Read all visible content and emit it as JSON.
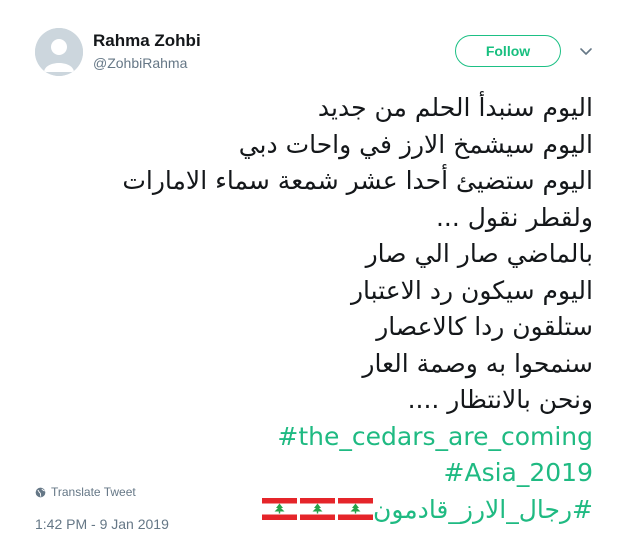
{
  "user": {
    "name": "Rahma Zohbi",
    "handle": "@ZohbiRahma",
    "avatar_icon": "default-avatar-icon"
  },
  "follow_button": {
    "label": "Follow"
  },
  "more_icon": "chevron-down-icon",
  "tweet": {
    "lines": [
      "اليوم سنبدأ الحلم من جديد",
      "اليوم سيشمخ الارز في واحات دبي",
      "اليوم ستضيئ أحدا عشر شمعة سماء الامارات",
      "ولقطر نقول ...",
      "بالماضي صار الي صار",
      "اليوم سيكون رد الاعتبار",
      "ستلقون ردا كالاعصار",
      "سنمحوا به وصمة العار",
      "ونحن بالانتظار ...."
    ],
    "hashtags": [
      "#the_cedars_are_coming",
      "#Asia_2019",
      "#رجال_الارز_قادمون"
    ],
    "flags": [
      "lebanon-flag-icon",
      "lebanon-flag-icon",
      "lebanon-flag-icon"
    ]
  },
  "translate": {
    "label": "Translate Tweet",
    "icon": "globe-icon"
  },
  "timestamp": "1:42 PM - 9 Jan 2019",
  "colors": {
    "accent_green": "#1fba82",
    "text": "#14171a",
    "secondary": "#657786",
    "avatar_bg": "#ccd6dd",
    "flag_red": "#e5252a",
    "cedar_green": "#25a34a"
  }
}
